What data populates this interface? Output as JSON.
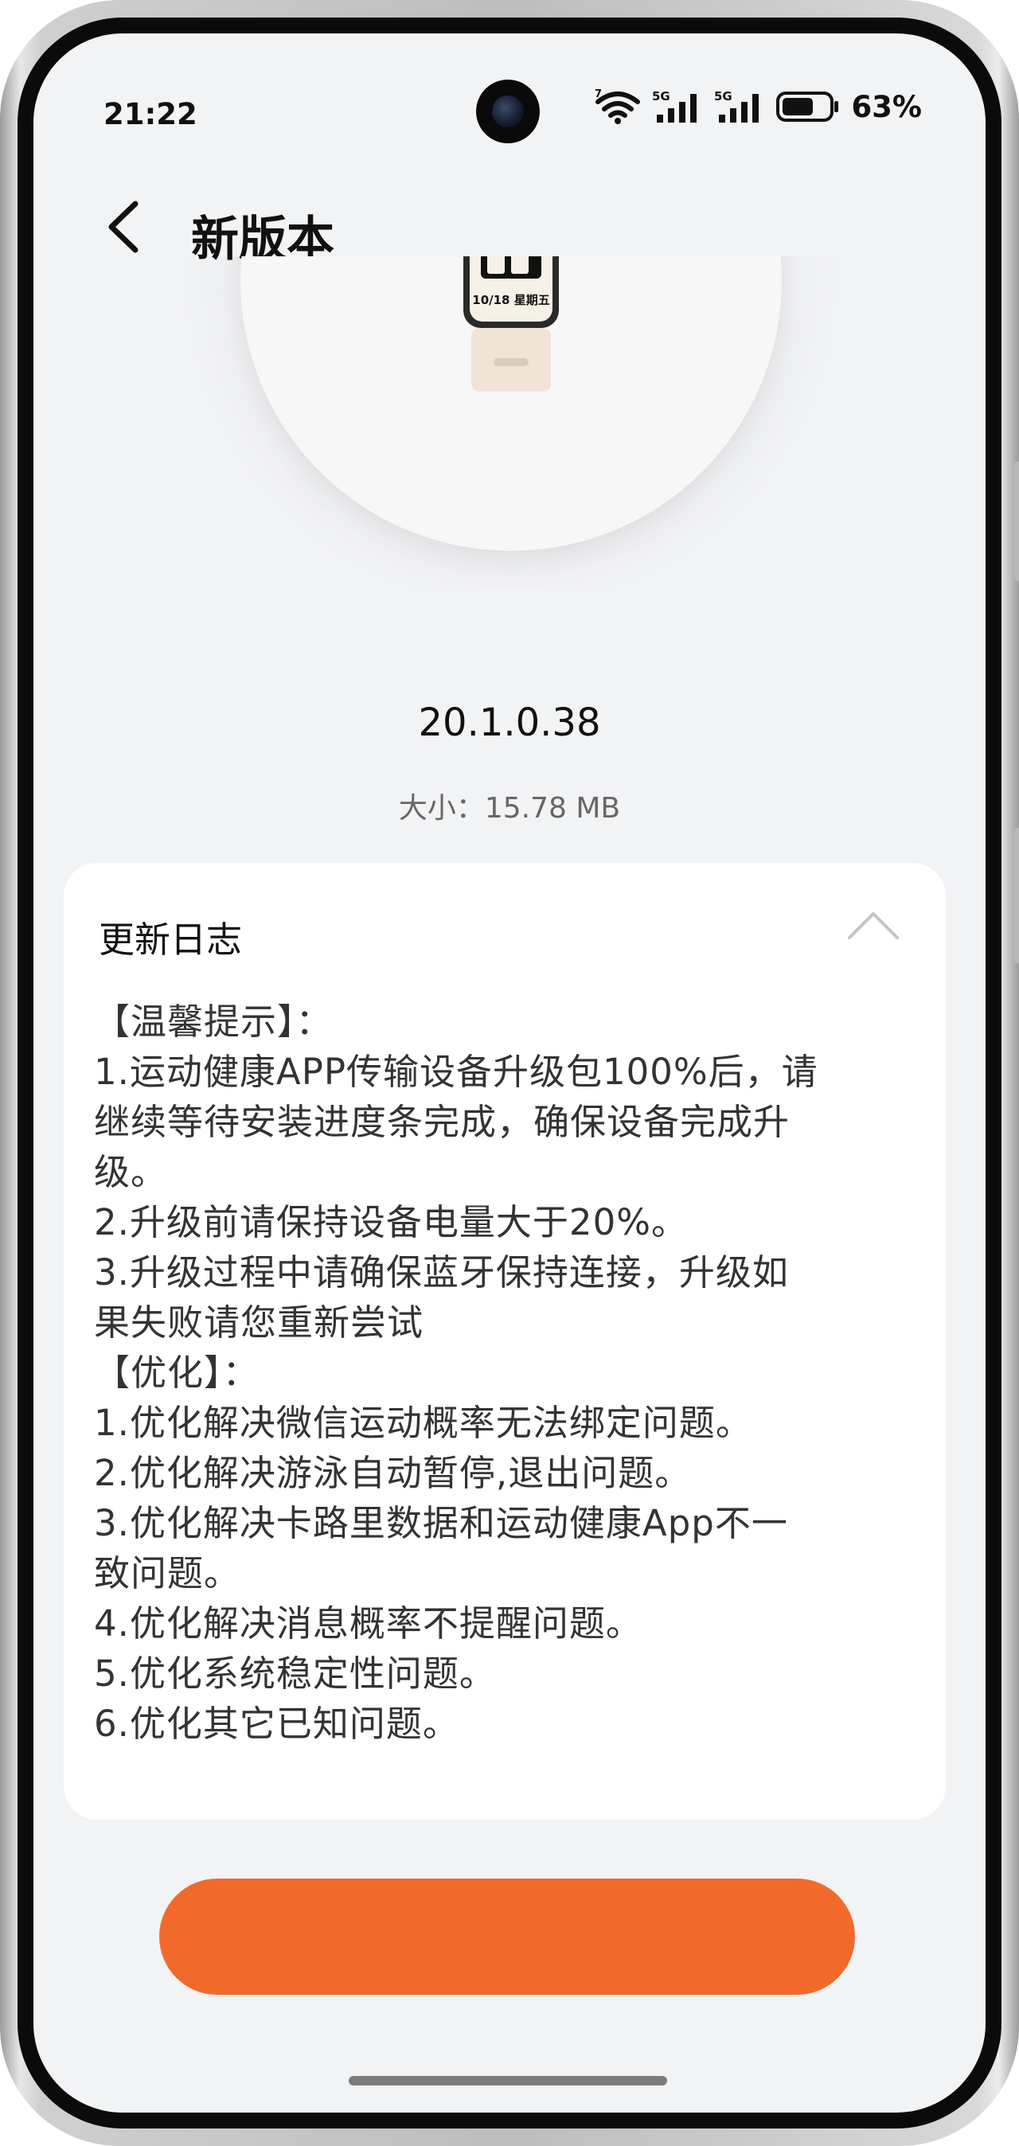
{
  "status_bar": {
    "time": "21:22",
    "battery_percent": "63%",
    "wifi_badge": "7",
    "sim1_label": "5G",
    "sim2_label": "5G"
  },
  "appbar": {
    "title": "新版本"
  },
  "hero": {
    "watch_date": "10/18 星期五"
  },
  "firmware": {
    "version": "20.1.0.38",
    "size": "大小：15.78 MB"
  },
  "changelog": {
    "title": "更新日志",
    "lines": [
      "【温馨提示】：",
      "1.运动健康APP传输设备升级包100%后，请",
      "继续等待安装进度条完成，确保设备完成升",
      "级。",
      "2.升级前请保持设备电量大于20%。",
      "3.升级过程中请确保蓝牙保持连接，升级如",
      "果失败请您重新尝试",
      "【优化】：",
      "1.优化解决微信运动概率无法绑定问题。",
      "2.优化解决游泳自动暂停,退出问题。",
      "3.优化解决卡路里数据和运动健康App不一",
      "致问题。",
      "4.优化解决消息概率不提醒问题。",
      "5.优化系统稳定性问题。",
      "6.优化其它已知问题。"
    ]
  },
  "colors": {
    "accent": "#f26a2b",
    "background": "#f2f3f5",
    "card": "#ffffff"
  }
}
